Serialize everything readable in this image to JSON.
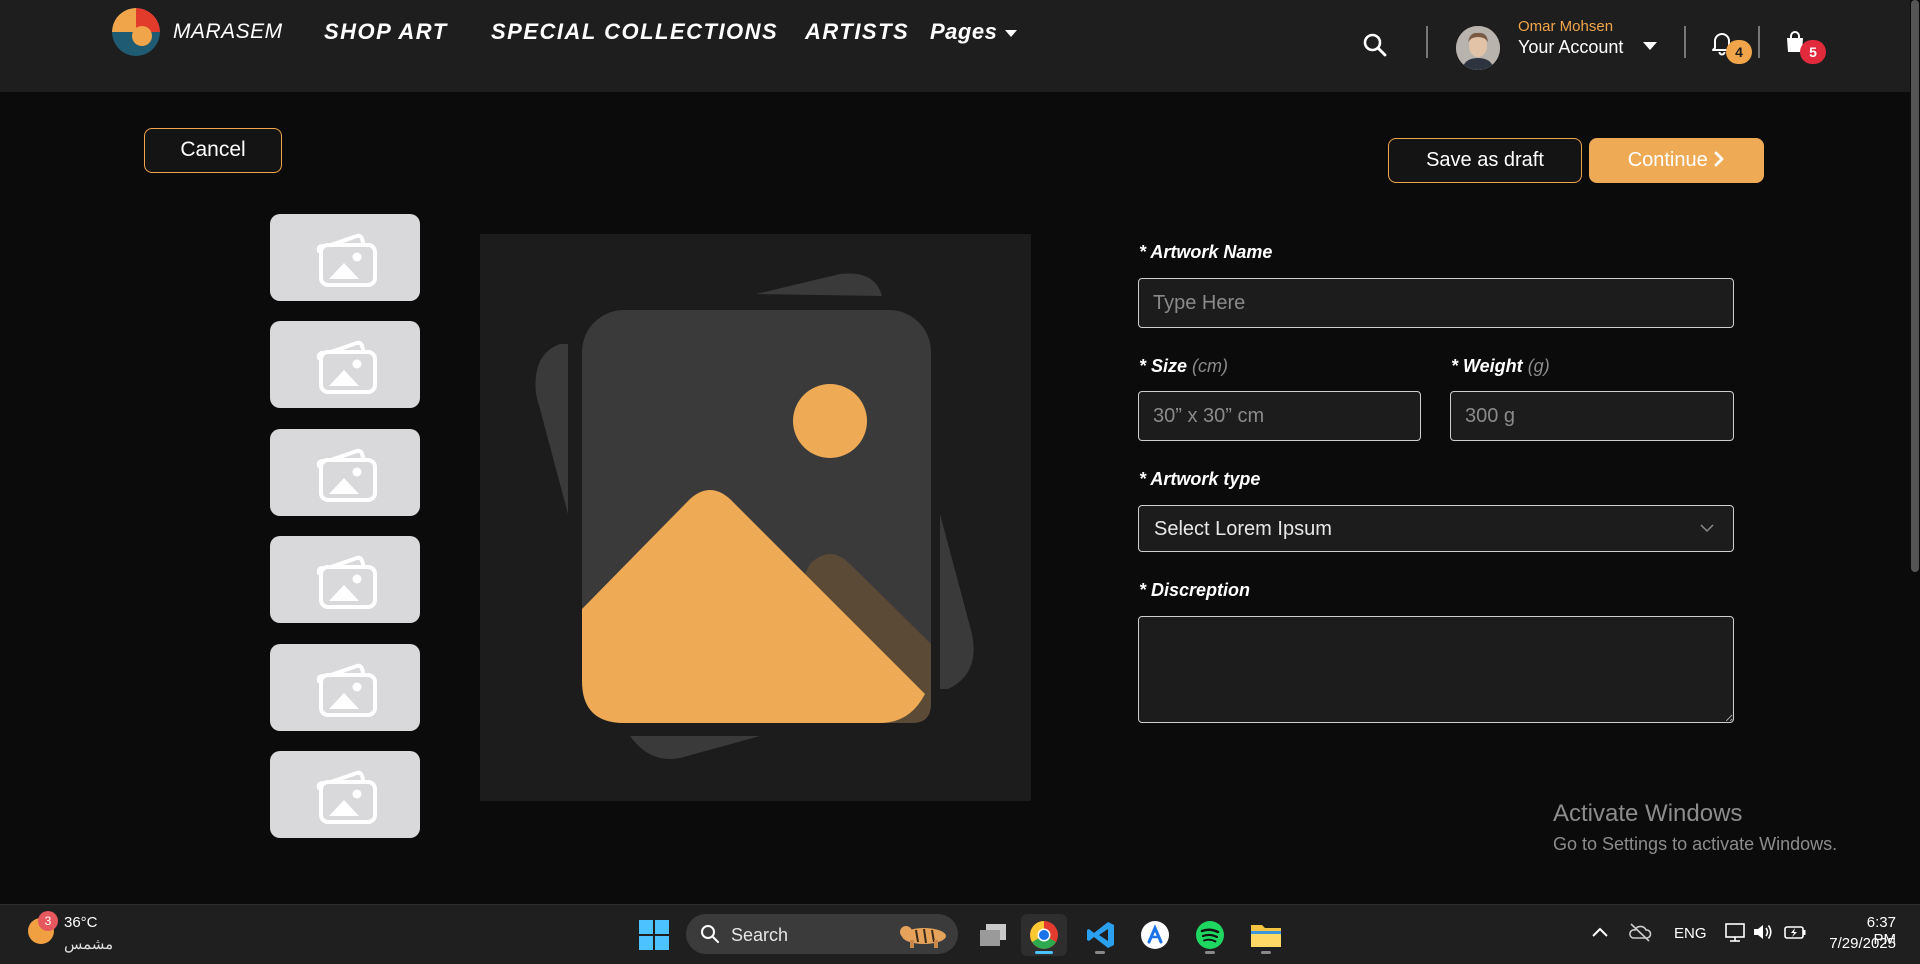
{
  "header": {
    "brand": "MARASEM",
    "nav": [
      "SHOP ART",
      "SPECIAL COLLECTIONS",
      "ARTISTS",
      "Pages"
    ],
    "account_name": "Omar Mohsen",
    "account_label": "Your Account",
    "notifications_count": "4",
    "cart_count": "5"
  },
  "actions": {
    "cancel": "Cancel",
    "save_draft": "Save as draft",
    "continue": "Continue"
  },
  "form": {
    "artwork_name_label": "* Artwork Name",
    "artwork_name_placeholder": "Type Here",
    "size_label": "* Size",
    "size_unit": "(cm)",
    "size_placeholder": "30” x 30” cm",
    "weight_label": "* Weight",
    "weight_unit": "(g)",
    "weight_placeholder": "300 g",
    "type_label": "* Artwork type",
    "type_value": "Select Lorem Ipsum",
    "description_label": "* Discreption"
  },
  "watermark": {
    "title": "Activate Windows",
    "subtitle": "Go to Settings to activate Windows."
  },
  "taskbar": {
    "weather_badge": "3",
    "weather_temp": "36°C",
    "weather_desc": "مشمس",
    "search_label": "Search",
    "language": "ENG",
    "time": "6:37 PM",
    "date": "7/29/2025"
  },
  "colors": {
    "accent": "#eeaa55",
    "background": "#0b0b0b",
    "header": "#1e1e1e",
    "badge_red": "#e22a3d"
  },
  "icons": {
    "search": "search-icon",
    "bell": "bell-icon",
    "cart": "shopping-bag-icon",
    "image": "image-placeholder-icon",
    "chevron": "chevron-down-icon"
  }
}
